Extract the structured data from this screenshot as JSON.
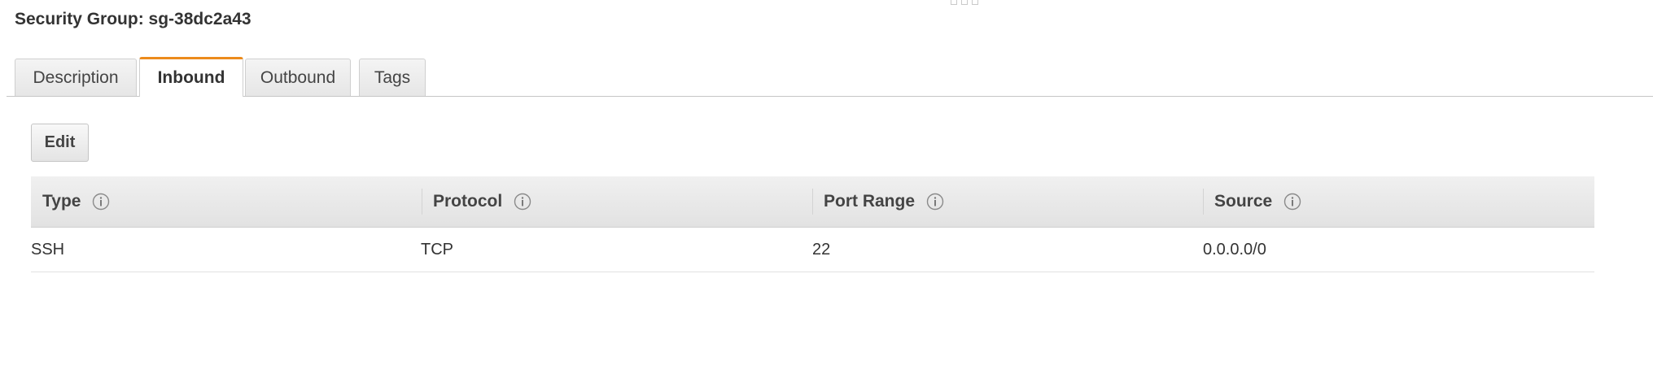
{
  "header": {
    "title": "Security Group: sg-38dc2a43"
  },
  "tabs": [
    {
      "label": "Description",
      "active": false
    },
    {
      "label": "Inbound",
      "active": true
    },
    {
      "label": "Outbound",
      "active": false
    },
    {
      "label": "Tags",
      "active": false
    }
  ],
  "toolbar": {
    "edit_label": "Edit"
  },
  "colors": {
    "active_tab_accent": "#ec8b1c",
    "header_bg": "#e6e6e6",
    "text": "#333333"
  },
  "table": {
    "columns": [
      "Type",
      "Protocol",
      "Port Range",
      "Source"
    ],
    "column_icon": "info-icon",
    "rows": [
      [
        "SSH",
        "TCP",
        "22",
        "0.0.0.0/0"
      ]
    ]
  }
}
